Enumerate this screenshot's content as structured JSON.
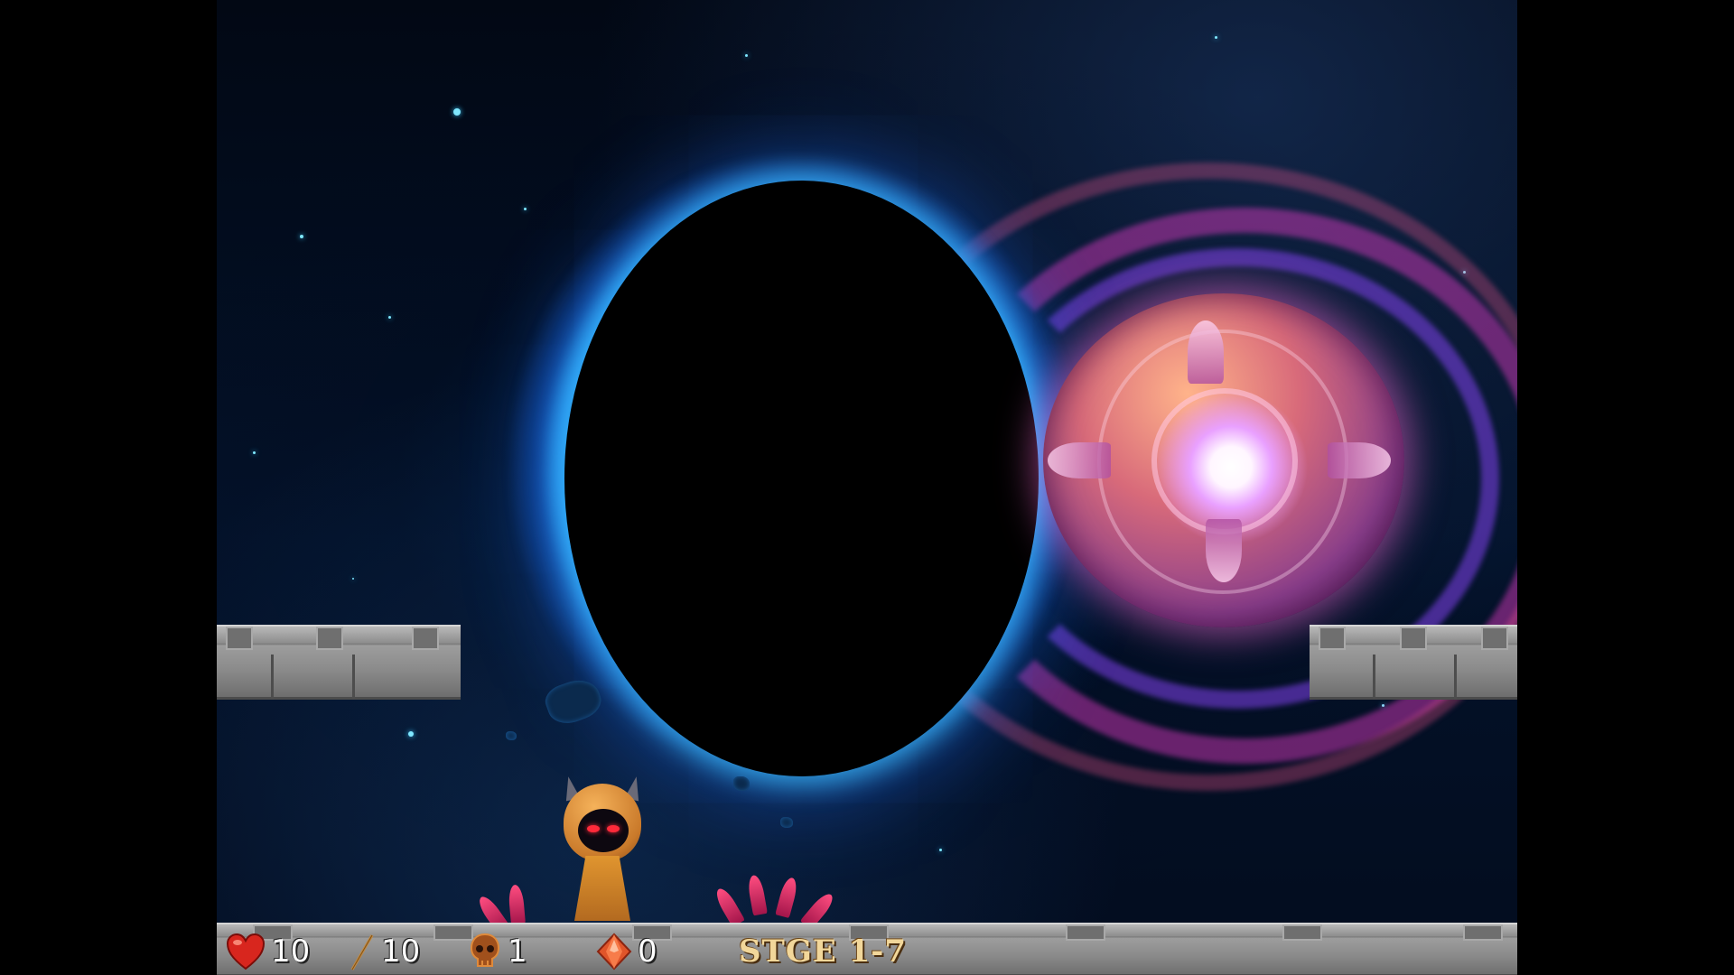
{
  "hud": {
    "lives": "10",
    "arrows": "10",
    "kills": "1",
    "gems": "0",
    "stage": "STGE 1-7"
  },
  "icons": {
    "lives": "heart-icon",
    "arrows": "arrow-icon",
    "kills": "skull-icon",
    "gems": "gem-icon"
  },
  "colors": {
    "hole_glow": "#3cbeff",
    "orb_pink": "#e65cc8",
    "stage_text": "#f2d79a"
  }
}
